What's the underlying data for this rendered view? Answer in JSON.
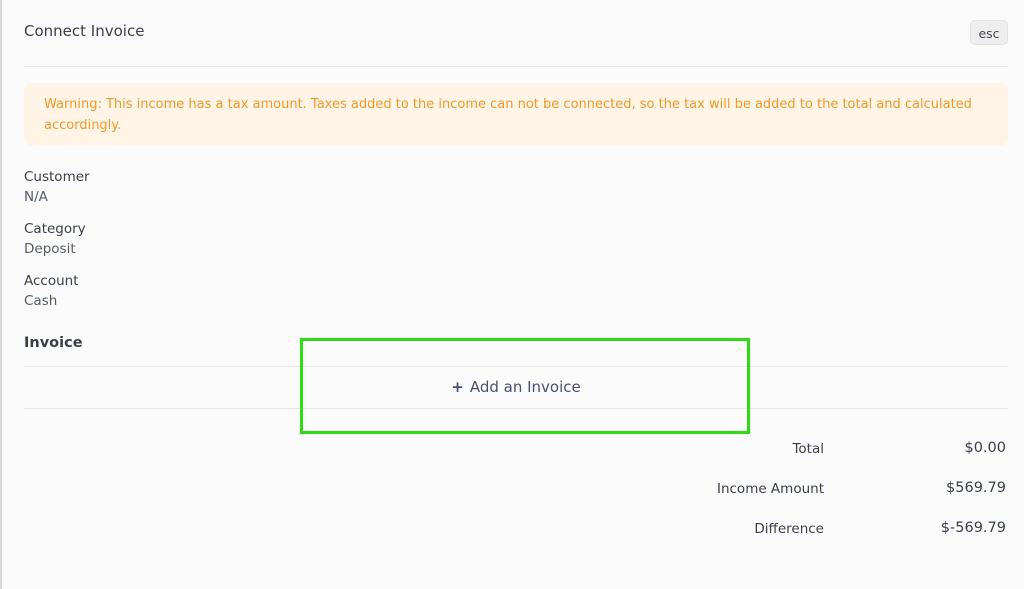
{
  "modal": {
    "title": "Connect Invoice",
    "esc_label": "esc"
  },
  "warning": {
    "text": "Warning: This income has a tax amount. Taxes added to the income can not be connected, so the tax will be added to the total and calculated accordingly.",
    "color": "#ef9a2a",
    "background": "#fff4e5"
  },
  "details": {
    "customer_label": "Customer",
    "customer_value": "N/A",
    "category_label": "Category",
    "category_value": "Deposit",
    "account_label": "Account",
    "account_value": "Cash"
  },
  "invoice_section": {
    "title": "Invoice",
    "add_icon": "plus-icon",
    "add_label": "Add an Invoice",
    "highlight_color": "#2fdc14"
  },
  "summary": {
    "total_label": "Total",
    "total_value": "$0.00",
    "income_label": "Income Amount",
    "income_value": "$569.79",
    "difference_label": "Difference",
    "difference_value": "$-569.79"
  }
}
